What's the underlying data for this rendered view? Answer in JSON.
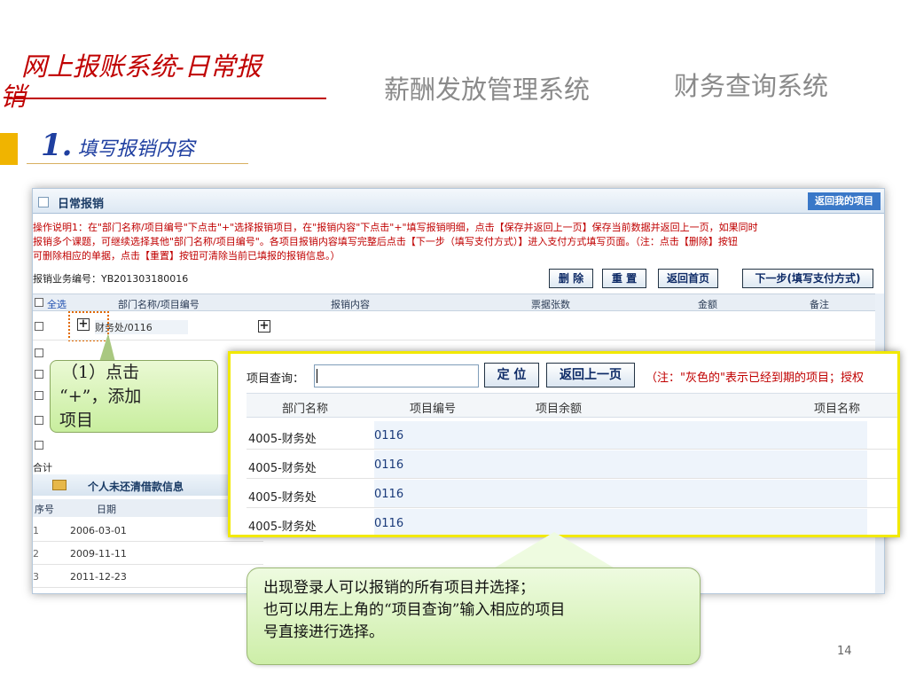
{
  "slide": {
    "title_line1": "网上报账系统-日常报",
    "title_line2": "销",
    "salary_system": "薪酬发放管理系统",
    "finance_system": "财务查询系统",
    "step_number": "1.",
    "step_text": "填写报销内容",
    "page_number": "14"
  },
  "window": {
    "title": "日常报销",
    "back_mine_button": "返回我的项目",
    "instructions": [
      "操作说明1：在\"部门名称/项目编号\"下点击\"+\"选择报销项目，在\"报销内容\"下点击\"+\"填写报销明细，点击【保存并返回上一页】保存当前数据并返回上一页，如果同时",
      "报销多个课题，可继续选择其他\"部门名称/项目编号\"。各项目报销内容填写完整后点击【下一步（填写支付方式）】进入支付方式填写页面。（注：点击【删除】按钮",
      "可删除相应的单据，点击【重置】按钮可清除当前已填报的报销信息。）"
    ],
    "business_code": "报销业务编号：YB201303180016",
    "buttons": {
      "delete": "删 除",
      "reset": "重 置",
      "home": "返回首页",
      "next": "下一步(填写支付方式)"
    },
    "columns": {
      "select_all": "全选",
      "dept_project": "部门名称/项目编号",
      "content": "报销内容",
      "tickets": "票据张数",
      "amount": "金额",
      "note": "备注"
    },
    "row1_text": "财务处/0116",
    "total_label": "合计",
    "loan": {
      "title": "个人未还清借款信息",
      "col_no": "序号",
      "col_date": "日期",
      "rows": [
        {
          "idx": "1",
          "date": "2006-03-01"
        },
        {
          "idx": "2",
          "date": "2009-11-11"
        },
        {
          "idx": "3",
          "date": "2011-12-23"
        }
      ]
    }
  },
  "popup": {
    "search_label": "项目查询：",
    "search_value": "",
    "locate_button": "定 位",
    "back_button": "返回上一页",
    "note": "（注：\"灰色的\"表示已经到期的项目；授权",
    "columns": {
      "dept": "部门名称",
      "project_no": "项目编号",
      "balance": "项目余额",
      "project_name": "项目名称"
    },
    "rows": [
      {
        "dept": "4005-财务处",
        "no": "0116"
      },
      {
        "dept": "4005-财务处",
        "no": "0116"
      },
      {
        "dept": "4005-财务处",
        "no": "0116"
      },
      {
        "dept": "4005-财务处",
        "no": "0116"
      }
    ]
  },
  "callouts": {
    "step1_line1": "（1）点击",
    "step1_line2": "“+”，添加",
    "step1_line3": "项目",
    "desc_line1": "出现登录人可以报销的所有项目并选择；",
    "desc_line2": "也可以用左上角的“项目查询”输入相应的项目",
    "desc_line3": "号直接进行选择。"
  },
  "colors": {
    "title_red": "#c00000",
    "accent_gold": "#f0b400",
    "popup_border_yellow": "#f2e900",
    "callout_green": "#cdeea8"
  }
}
